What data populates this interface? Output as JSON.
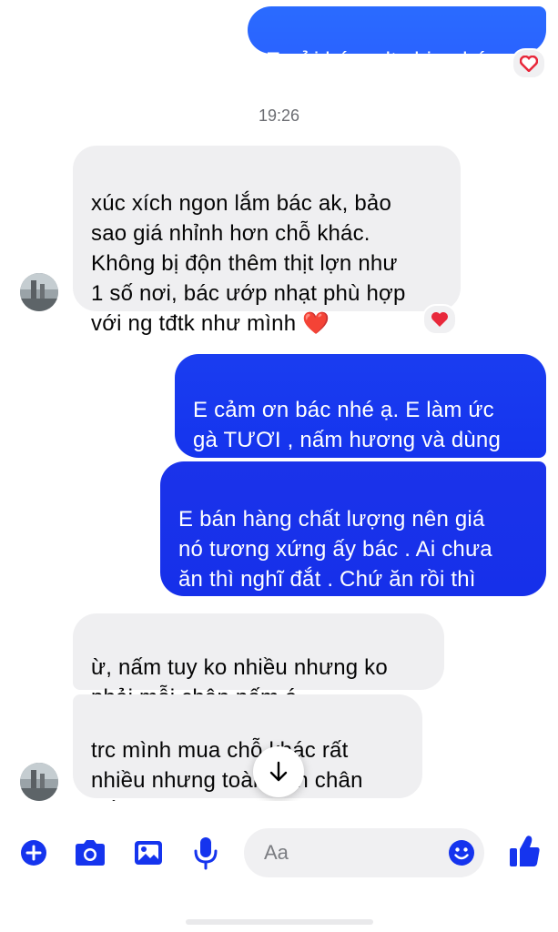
{
  "messages": [
    {
      "id": "m1",
      "text": "E gửi bác sdt ship nhé ạ"
    },
    {
      "id": "m2",
      "text": "xúc xích ngon lắm bác ak, bảo\nsao giá nhỉnh hơn chỗ khác.\nKhông bị độn thêm thịt lợn như\n1 số nơi, bác ướp nhạt phù hợp\nvới ng tđtk như mình ❤️"
    },
    {
      "id": "m3",
      "text": "E cảm ơn bác nhé ạ. E làm ức\ngà TƯƠI , nấm hương và dùng\ndầu oliu"
    },
    {
      "id": "m4",
      "text": "E bán hàng chất lượng nên giá\nnó tương xứng ấy bác . Ai chưa\năn thì nghĩ đắt . Chứ ăn rồi thì\nthấy phù hợp bác nhỏ"
    },
    {
      "id": "m5",
      "text": "ừ, nấm tuy ko nhiều nhưng ko\nphải mỗi chân nấm á"
    },
    {
      "id": "m6",
      "text": "trc mình mua chỗ khác rất\nnhiều nhưng toàn độn chân\nnấm thôi"
    }
  ],
  "timestamp": "19:26",
  "composer": {
    "placeholder": "Aa",
    "icons": [
      "plus-icon",
      "camera-icon",
      "image-icon",
      "microphone-icon",
      "emoji-icon",
      "thumbs-up-icon"
    ]
  },
  "reactions": [
    "heart-reaction",
    "heart-reaction"
  ],
  "colors": {
    "accent": "#1a3df0",
    "incoming": "#efeff1",
    "heart": "#e8283b"
  }
}
